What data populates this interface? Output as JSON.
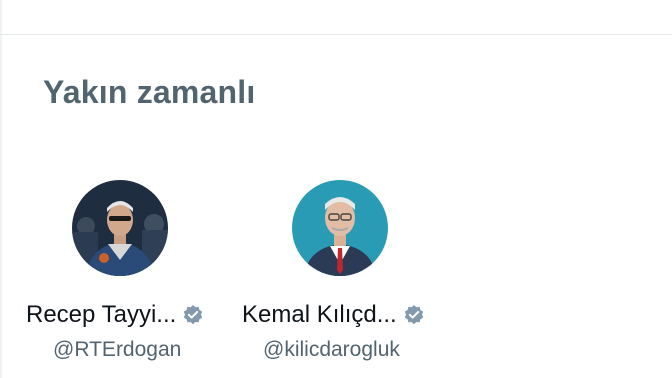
{
  "section": {
    "title": "Yakın zamanlı"
  },
  "accounts": [
    {
      "display_name": "Recep Tayyi...",
      "handle": "@RTErdogan",
      "verified": true,
      "avatar_icon": "avatar-photo",
      "avatar_bg": "#1d2a3a"
    },
    {
      "display_name": "Kemal Kılıçd...",
      "handle": "@kilicdarogluk",
      "verified": true,
      "avatar_icon": "avatar-photo",
      "avatar_bg": "#2a9bb5"
    }
  ],
  "colors": {
    "title": "#536471",
    "name": "#0f1419",
    "handle": "#536471",
    "verified_badge": "#829aab",
    "divider": "#e3e7ea"
  }
}
